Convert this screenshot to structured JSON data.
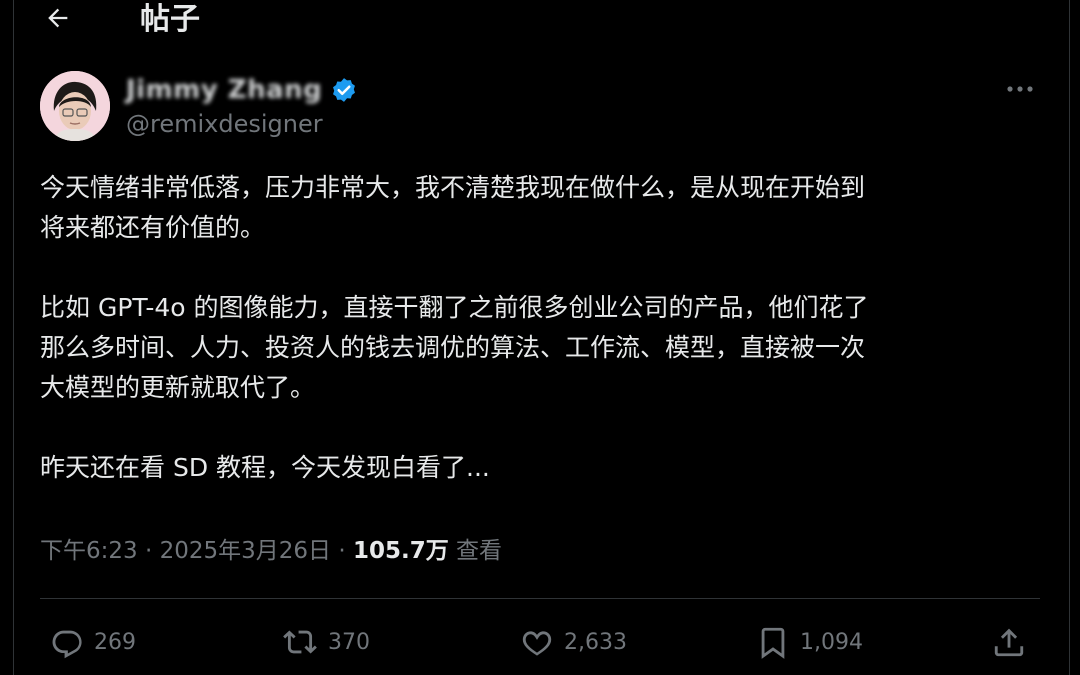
{
  "header": {
    "back_icon": "arrow-left-icon",
    "title": "帖子"
  },
  "author": {
    "display_name": "Jimmy Zhang",
    "handle": "@remixdesigner",
    "verified": true,
    "verified_color": "#1d9bf0",
    "more_icon": "more-horizontal-icon"
  },
  "post": {
    "paragraphs": [
      "今天情绪非常低落，压力非常大，我不清楚我现在做什么，是从现在开始到\n将来都还有价值的。",
      "比如 GPT-4o 的图像能力，直接干翻了之前很多创业公司的产品，他们花了\n那么多时间、人力、投资人的钱去调优的算法、工作流、模型，直接被一次\n大模型的更新就取代了。",
      "昨天还在看 SD 教程，今天发现白看了..."
    ],
    "time": "下午6:23",
    "date": "2025年3月26日",
    "separator": "·",
    "views_count": "105.7万",
    "views_label": "查看"
  },
  "actions": {
    "replies": {
      "icon": "reply-icon",
      "count": "269"
    },
    "reposts": {
      "icon": "repost-icon",
      "count": "370"
    },
    "likes": {
      "icon": "heart-icon",
      "count": "2,633"
    },
    "bookmarks": {
      "icon": "bookmark-icon",
      "count": "1,094"
    },
    "share": {
      "icon": "share-icon"
    }
  },
  "colors": {
    "background": "#000000",
    "text": "#e7e9ea",
    "muted": "#71767b",
    "divider": "#2f3336",
    "accent": "#1d9bf0"
  }
}
